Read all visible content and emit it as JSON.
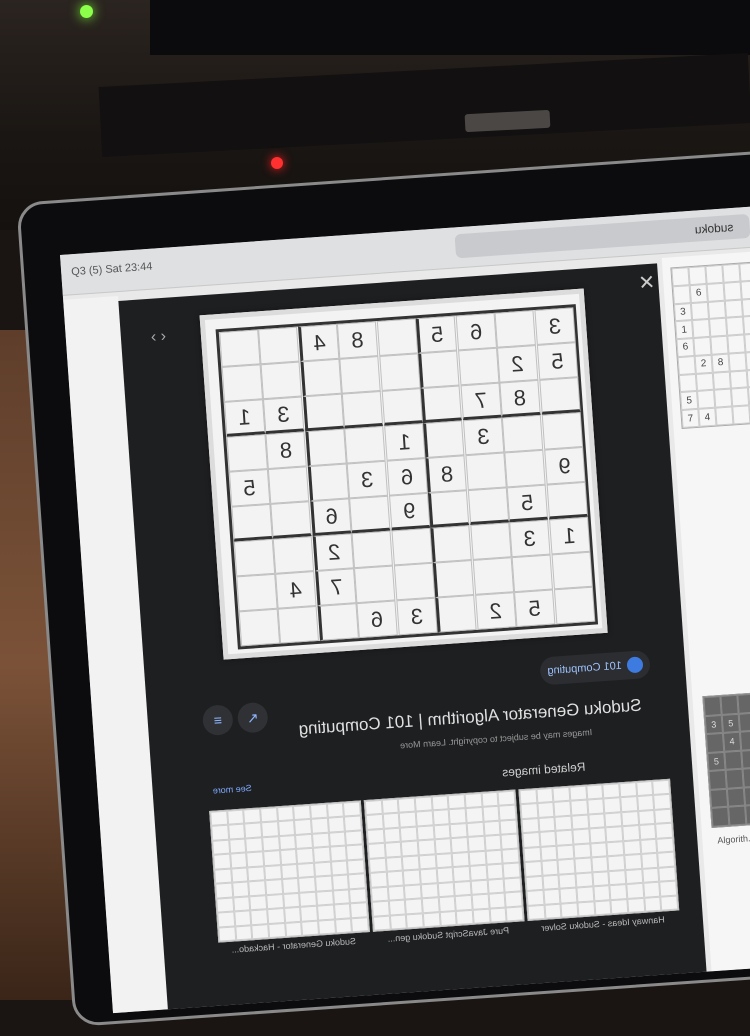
{
  "browser": {
    "search_query": "sudoku",
    "status_bar": "Q3 (5) Sat 23:44"
  },
  "lightbox": {
    "title": "Sudoku Generator Algorithm | 101 Computing",
    "subtitle": "Images may be subject to copyright. Learn More",
    "source": "101 Computing",
    "related_label": "Related images",
    "see_more": "See more",
    "sudoku_grid": [
      [
        "",
        "",
        "4",
        "8",
        "",
        "5",
        "6",
        "",
        "3"
      ],
      [
        "",
        "",
        "",
        "",
        "",
        "",
        "",
        "2",
        "5"
      ],
      [
        "1",
        "3",
        "",
        "",
        "",
        "",
        "7",
        "8",
        ""
      ],
      [
        "",
        "8",
        "",
        "",
        "1",
        "",
        "3",
        "",
        ""
      ],
      [
        "5",
        "",
        "",
        "3",
        "6",
        "8",
        "",
        "",
        "9"
      ],
      [
        "",
        "",
        "6",
        "",
        "9",
        "",
        "",
        "5",
        ""
      ],
      [
        "",
        "",
        "2",
        "",
        "",
        "",
        "",
        "3",
        "1"
      ],
      [
        "",
        "4",
        "7",
        "",
        "",
        "",
        "",
        "",
        ""
      ],
      [
        "",
        "",
        "",
        "6",
        "3",
        "",
        "2",
        "5",
        ""
      ]
    ],
    "thumbnails": [
      {
        "label": "Hanway Ideas - Sudoku Solver"
      },
      {
        "label": "Pure JavaScript Sudoku gen..."
      },
      {
        "label": "Sudoku Generator - Hackado..."
      }
    ]
  },
  "right_results": {
    "mini_grid": [
      "",
      "",
      "",
      "",
      "",
      "",
      "6",
      "",
      "",
      "",
      "3",
      "",
      "",
      "",
      "",
      "1",
      "",
      "",
      "",
      "",
      "6",
      "",
      "",
      "",
      "",
      "",
      "2",
      "8",
      "",
      "",
      "",
      "",
      "",
      "",
      "",
      "5",
      "",
      "",
      "",
      "",
      "7",
      "4",
      "",
      "",
      ""
    ],
    "mini_dark": [
      "",
      "",
      "",
      "",
      "",
      "3",
      "5",
      "",
      "",
      "",
      "",
      "4",
      "",
      "",
      "",
      "5",
      "",
      "",
      "",
      "",
      "",
      "",
      "",
      "",
      "",
      "",
      "",
      "",
      "",
      "",
      "",
      "",
      "",
      "",
      ""
    ],
    "caption": "Algorith..."
  }
}
